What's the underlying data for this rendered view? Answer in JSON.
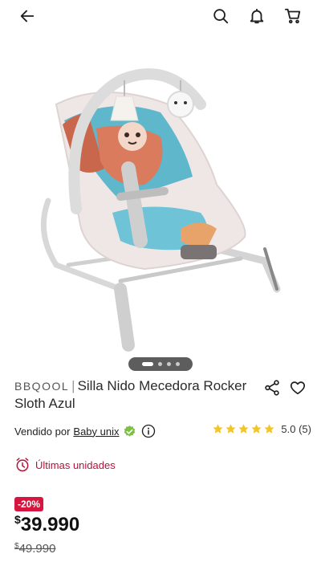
{
  "header": {
    "back_icon": "arrow-left-icon",
    "search_icon": "search-icon",
    "notifications_icon": "bell-icon",
    "cart_icon": "cart-icon"
  },
  "gallery": {
    "pages_total": 4,
    "current_page": 1
  },
  "product": {
    "brand": "BBQOOL",
    "separator": "|",
    "name": "Silla Nido Mecedora Rocker Sloth Azul",
    "share_icon": "share-icon",
    "favorite_icon": "heart-icon"
  },
  "seller": {
    "prefix": "Vendido por",
    "name": "Baby unix",
    "verified_icon": "verified-check-icon",
    "info_icon": "info-icon"
  },
  "rating": {
    "stars": 5,
    "text": "5.0 (5)"
  },
  "stock": {
    "icon": "alarm-clock-icon",
    "label": "Últimas unidades"
  },
  "pricing": {
    "discount": "-20%",
    "currency": "$",
    "price": "39.990",
    "old_price": "49.990"
  },
  "colors": {
    "accent": "#d6163f",
    "stock_text": "#b5123a",
    "star": "#f4c52b",
    "verified": "#7cc142"
  }
}
